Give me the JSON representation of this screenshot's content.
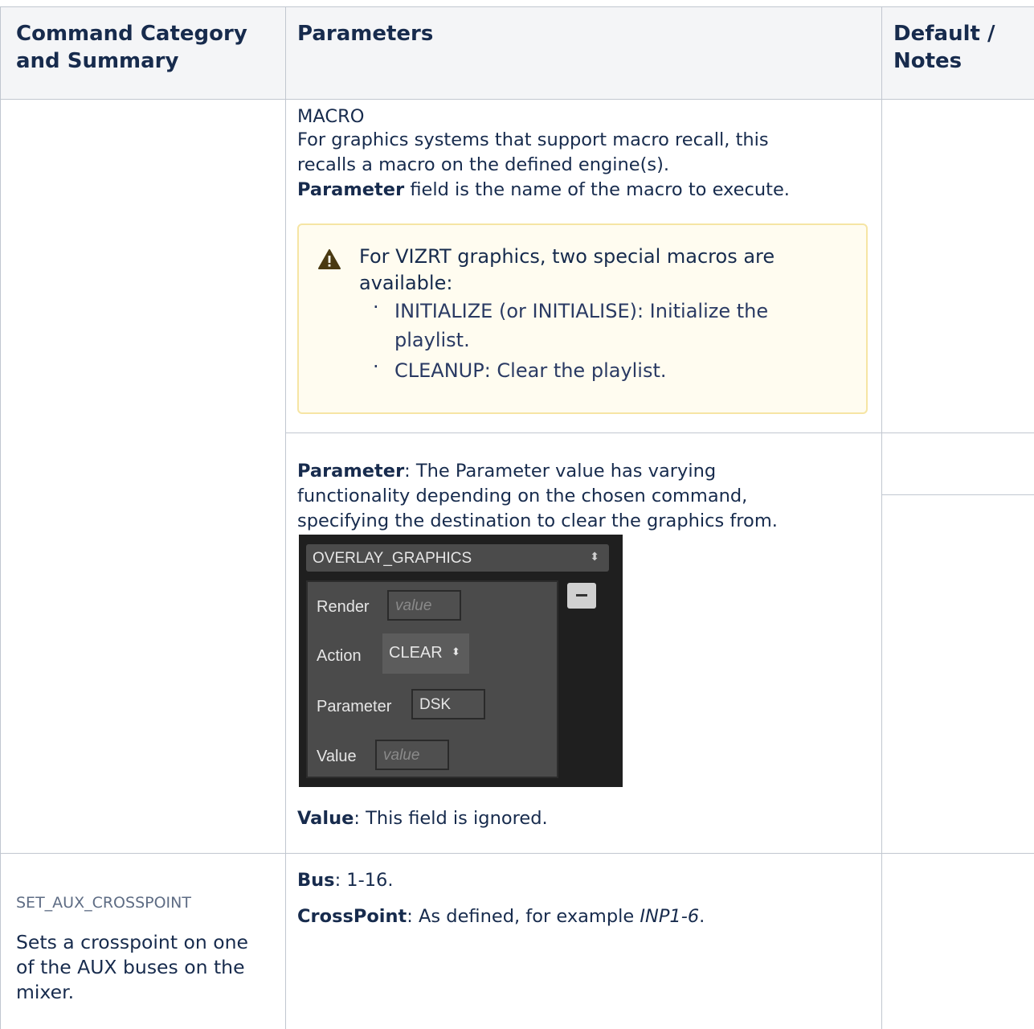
{
  "table": {
    "headers": [
      {
        "line1": "Command Category",
        "line2": "and Summary"
      },
      {
        "line1": "Parameters"
      },
      {
        "line1": "Default /",
        "line2": "Notes"
      }
    ]
  },
  "macro": {
    "title": "MACRO",
    "desc_line1": "For graphics systems that support macro recall, this",
    "desc_line2": "recalls a macro on the defined engine(s).",
    "param_bold": "Parameter",
    "param_rest": " field is the name of the macro to execute."
  },
  "note": {
    "text_line1": "For VIZRT graphics, two special macros are",
    "text_line2": "available:",
    "items": [
      {
        "line1": "INITIALIZE (or INITIALISE): Initialize the",
        "line2": "playlist."
      },
      {
        "line1": "CLEANUP: Clear the playlist."
      }
    ]
  },
  "clear": {
    "param_bold": "Parameter",
    "param_line1": ": The Parameter value has varying",
    "param_line2": "functionality depending on the chosen command,",
    "param_line3": "specifying the destination to clear the graphics from.",
    "value_bold": "Value",
    "value_rest": ": This field is ignored."
  },
  "widget": {
    "dropdown_value": "OVERLAY_GRAPHICS",
    "render_label": "Render",
    "action_label": "Action",
    "action_value": "CLEAR",
    "parameter_label": "Parameter",
    "parameter_value": "DSK",
    "value_label": "Value",
    "placeholder": "value"
  },
  "aux": {
    "command": "SET_AUX_CROSSPOINT",
    "summary_line1": "Sets a crosspoint on one",
    "summary_line2": "of the AUX buses on the",
    "summary_line3": "mixer.",
    "bus_bold": "Bus",
    "bus_rest": ": 1-16.",
    "cp_bold": "CrossPoint",
    "cp_rest": ": As defined, for example ",
    "cp_example": "INP1-6",
    "cp_end": "."
  }
}
